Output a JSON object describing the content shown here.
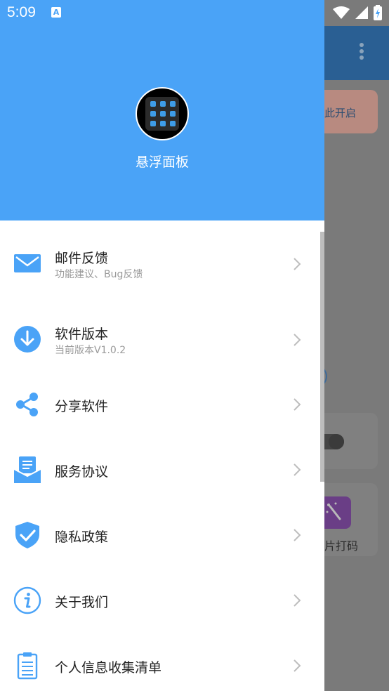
{
  "status_bar": {
    "time": "5:09",
    "notification_badge": "A"
  },
  "background_app": {
    "card_red_text": "此开启",
    "card_text": "片打码"
  },
  "drawer": {
    "app_name": "悬浮面板",
    "menu": [
      {
        "title": "邮件反馈",
        "subtitle": "功能建议、Bug反馈",
        "icon": "mail-icon"
      },
      {
        "title": "软件版本",
        "subtitle": "当前版本V1.0.2",
        "icon": "download-icon"
      },
      {
        "title": "分享软件",
        "subtitle": "",
        "icon": "share-icon"
      },
      {
        "title": "服务协议",
        "subtitle": "",
        "icon": "agreement-icon"
      },
      {
        "title": "隐私政策",
        "subtitle": "",
        "icon": "shield-check-icon"
      },
      {
        "title": "关于我们",
        "subtitle": "",
        "icon": "info-icon"
      },
      {
        "title": "个人信息收集清单",
        "subtitle": "",
        "icon": "clipboard-icon"
      }
    ]
  },
  "colors": {
    "primary": "#4aa3f7",
    "appbar": "#2a5f93"
  }
}
